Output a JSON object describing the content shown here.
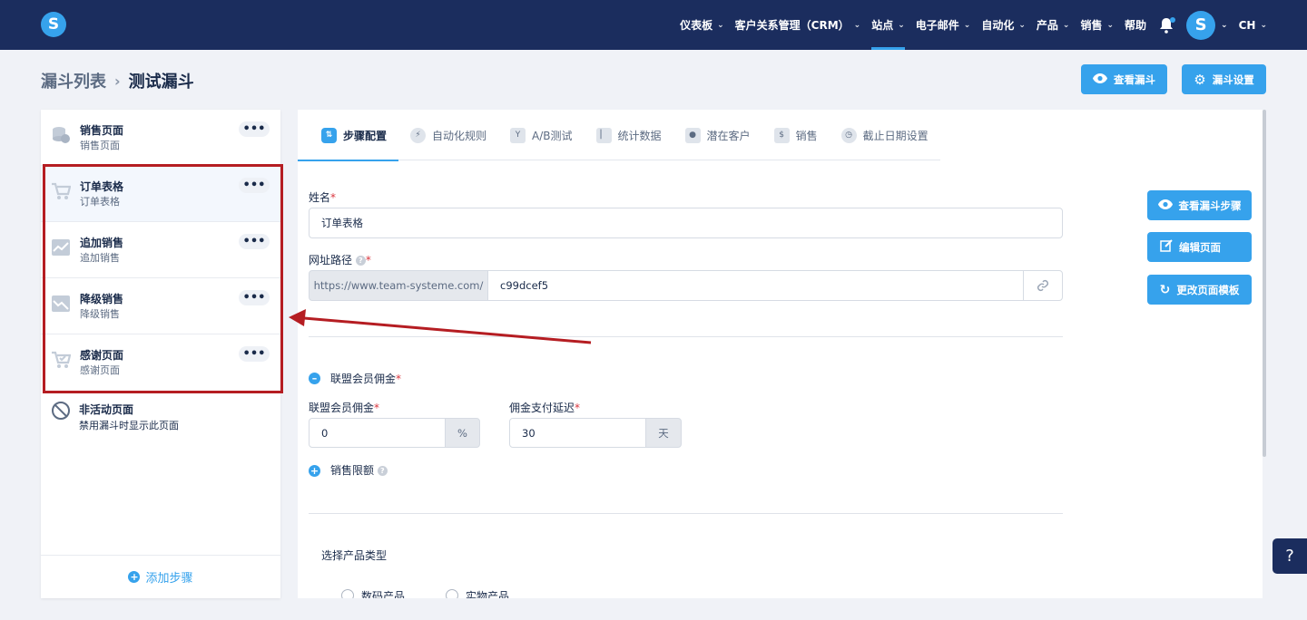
{
  "topbar": {
    "logo_letter": "S",
    "nav": [
      {
        "label": "仪表板",
        "chevron": true
      },
      {
        "label": "客户关系管理（CRM）",
        "chevron": true
      },
      {
        "label": "站点",
        "chevron": true,
        "active": true
      },
      {
        "label": "电子邮件",
        "chevron": true
      },
      {
        "label": "自动化",
        "chevron": true
      },
      {
        "label": "产品",
        "chevron": true
      },
      {
        "label": "销售",
        "chevron": true
      },
      {
        "label": "帮助",
        "chevron": false
      }
    ],
    "avatar_letter": "S",
    "language": "CH"
  },
  "breadcrumb": {
    "parent": "漏斗列表",
    "current": "测试漏斗"
  },
  "header_buttons": {
    "view_funnel": "查看漏斗",
    "funnel_settings": "漏斗设置"
  },
  "sidebar": {
    "steps": [
      {
        "title": "销售页面",
        "subtitle": "销售页面",
        "icon": "coins-icon"
      },
      {
        "title": "订单表格",
        "subtitle": "订单表格",
        "icon": "cart-icon",
        "selected": true
      },
      {
        "title": "追加销售",
        "subtitle": "追加销售",
        "icon": "chart-up-icon"
      },
      {
        "title": "降级销售",
        "subtitle": "降级销售",
        "icon": "chart-down-icon"
      },
      {
        "title": "感谢页面",
        "subtitle": "感谢页面",
        "icon": "cart-check-icon"
      }
    ],
    "inactive": {
      "title": "非活动页面",
      "subtitle": "禁用漏斗时显示此页面"
    },
    "add_step": "添加步骤"
  },
  "tabs": [
    {
      "label": "步骤配置",
      "active": true
    },
    {
      "label": "自动化规则"
    },
    {
      "label": "A/B测试"
    },
    {
      "label": "统计数据"
    },
    {
      "label": "潜在客户"
    },
    {
      "label": "销售"
    },
    {
      "label": "截止日期设置"
    }
  ],
  "form": {
    "name_label": "姓名",
    "name_value": "订单表格",
    "url_label": "网址路径",
    "url_prefix": "https://www.team-systeme.com/",
    "url_value": "c99dcef5",
    "affiliate_section": "联盟会员佣金",
    "commission_label": "联盟会员佣金",
    "commission_value": "0",
    "commission_unit": "%",
    "delay_label": "佣金支付延迟",
    "delay_value": "30",
    "delay_unit": "天",
    "sales_limit": "销售限额",
    "product_type_label": "选择产品类型",
    "product_digital": "数码产品",
    "product_physical": "实物产品"
  },
  "side_buttons": {
    "view_step": "查看漏斗步骤",
    "edit_page": "编辑页面",
    "change_template": "更改页面模板"
  },
  "help_label": "?",
  "colors": {
    "navy": "#1b2d5e",
    "accent": "#36a2ec",
    "highlight_red": "#b51d22"
  }
}
